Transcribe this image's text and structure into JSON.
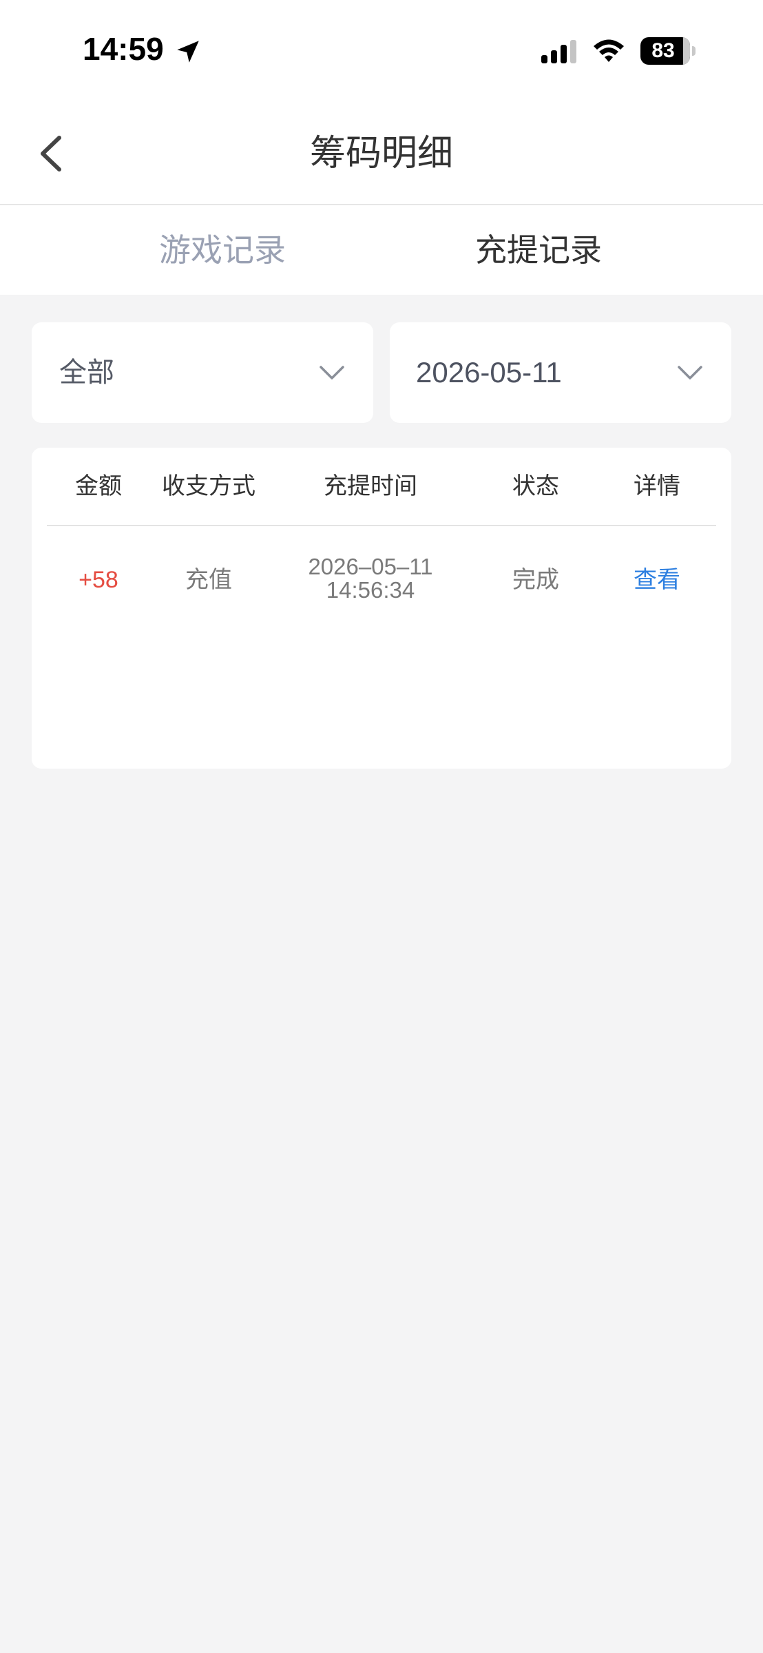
{
  "status_bar": {
    "time": "14:59",
    "battery": "83"
  },
  "nav": {
    "title": "筹码明细"
  },
  "tabs": [
    {
      "label": "游戏记录",
      "active": false
    },
    {
      "label": "充提记录",
      "active": true
    }
  ],
  "filters": {
    "type": "全部",
    "date": "2026-05-11"
  },
  "table": {
    "headers": [
      "金额",
      "收支方式",
      "充提时间",
      "状态",
      "详情"
    ],
    "rows": [
      {
        "amount": "+58",
        "method": "充值",
        "date": "2026–05–11",
        "time": "14:56:34",
        "status": "完成",
        "detail": "查看"
      }
    ]
  },
  "colors": {
    "amount_positive": "#e54d42",
    "link": "#2d7fe0",
    "inactive_tab": "#9aa1b3",
    "background": "#f4f4f5"
  },
  "icons": [
    "location-arrow-icon",
    "cellular-signal-icon",
    "wifi-icon",
    "battery-icon",
    "back-arrow-icon",
    "chevron-down-icon"
  ]
}
